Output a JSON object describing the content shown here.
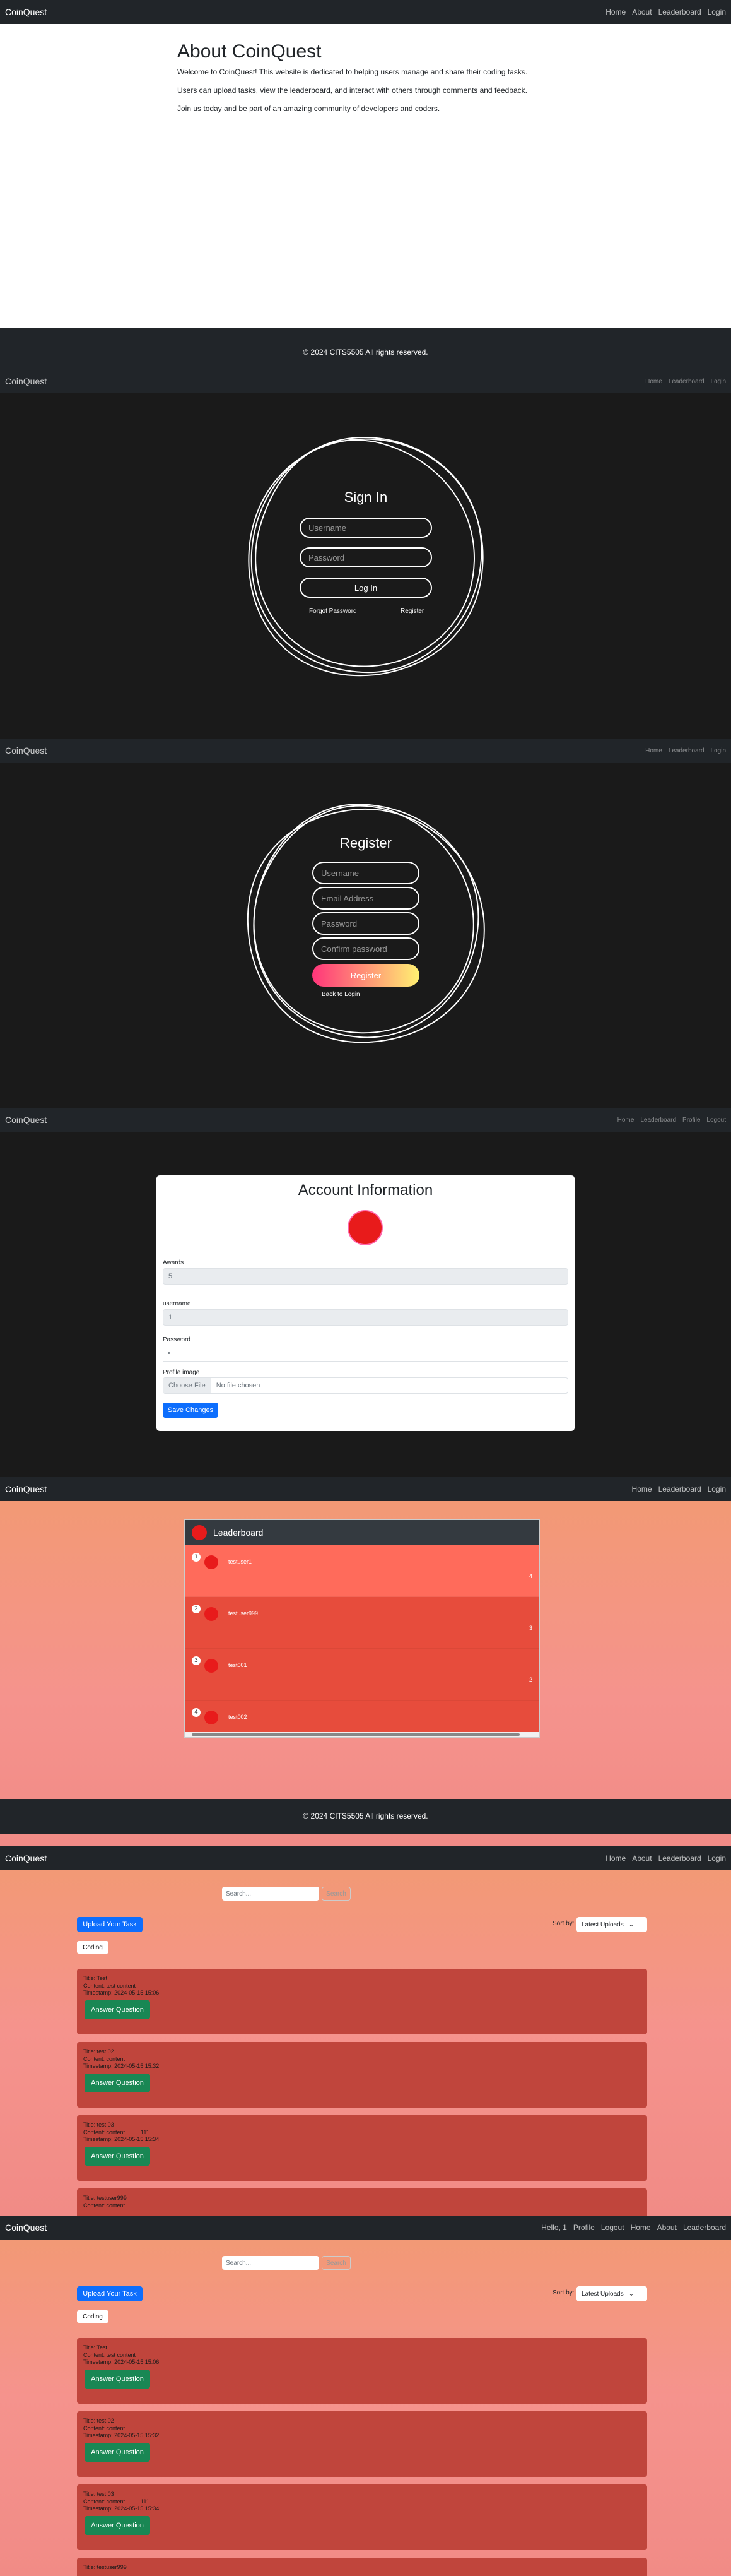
{
  "brand": "CoinQuest",
  "about": {
    "nav": [
      "Home",
      "About",
      "Leaderboard",
      "Login"
    ],
    "title": "About CoinQuest",
    "p1": "Welcome to CoinQuest! This website is dedicated to helping users manage and share their coding tasks.",
    "p2": "Users can upload tasks, view the leaderboard, and interact with others through comments and feedback.",
    "p3": "Join us today and be part of an amazing community of developers and coders.",
    "footer": "© 2024 CITS5505 All rights reserved."
  },
  "login": {
    "nav": [
      "Home",
      "Leaderboard",
      "Login"
    ],
    "title": "Sign In",
    "username_placeholder": "Username",
    "password_placeholder": "Password",
    "button": "Log In",
    "forgot": "Forgot Password",
    "register": "Register"
  },
  "register": {
    "nav": [
      "Home",
      "Leaderboard",
      "Login"
    ],
    "title": "Register",
    "username": "Username",
    "email": "Email Address",
    "password": "Password",
    "confirm": "Confirm password",
    "button": "Register",
    "back": "Back to Login"
  },
  "account": {
    "nav": [
      "Home",
      "Leaderboard",
      "Profile",
      "Logout"
    ],
    "title": "Account Information",
    "awards_label": "Awards",
    "awards_value": "5",
    "username_label": "username",
    "username_value": "1",
    "password_label": "Password",
    "password_value": "•",
    "profile_label": "Profile image",
    "file_button": "Choose File",
    "file_text": "No file chosen",
    "save": "Save Changes"
  },
  "leaderboard": {
    "nav": [
      "Home",
      "Leaderboard",
      "Login"
    ],
    "title": "Leaderboard",
    "rows": [
      {
        "rank": "1",
        "name": "testuser1",
        "score": "4"
      },
      {
        "rank": "2",
        "name": "testuser999",
        "score": "3"
      },
      {
        "rank": "3",
        "name": "test001",
        "score": "2"
      },
      {
        "rank": "4",
        "name": "test002",
        "score": ""
      }
    ],
    "footer": "© 2024 CITS5505 All rights reserved."
  },
  "tasks1": {
    "nav": [
      "Home",
      "About",
      "Leaderboard",
      "Login"
    ],
    "search_placeholder": "Search...",
    "search_btn": "Search",
    "upload": "Upload Your Task",
    "sort_label": "Sort by:",
    "sort_value": "Latest Uploads",
    "tag": "Coding",
    "answer": "Answer Question"
  },
  "tasks2": {
    "nav": [
      "Hello, 1",
      "Profile",
      "Logout",
      "Home",
      "About",
      "Leaderboard"
    ]
  },
  "task_items": [
    {
      "title": "Title: Test",
      "content": "Content: test content",
      "time": "Timestamp: 2024-05-15 15:06"
    },
    {
      "title": "Title: test 02",
      "content": "Content: content",
      "time": "Timestamp: 2024-05-15 15:32"
    },
    {
      "title": "Title: test 03",
      "content": "Content: content ........ 111",
      "time": "Timestamp: 2024-05-15 15:34"
    },
    {
      "title": "Title: testuser999",
      "content": "Content: content",
      "time": ""
    }
  ],
  "colors": {
    "accent": "#0d6efd",
    "success": "#198754",
    "task_card": "#c0453c",
    "leaderboard": "#e74c3c"
  }
}
